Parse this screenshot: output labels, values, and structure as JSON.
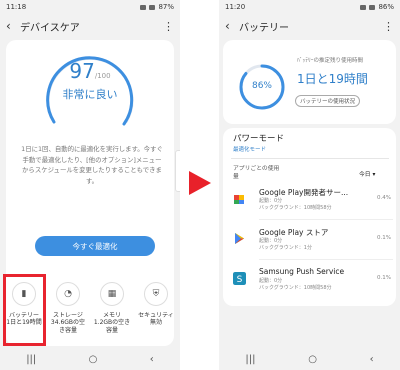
{
  "left": {
    "status": {
      "time": "11:18",
      "battery": "87%"
    },
    "title": "デバイスケア",
    "score": "97",
    "score_max": "/100",
    "score_label": "非常に良い",
    "description": "1日に1回、自動的に最適化を実行します。今すぐ手動で最適化したり、[他のオプション]メニューからスケジュールを変更したりすることもできます。",
    "optimize_button": "今すぐ最適化",
    "tiles": [
      {
        "label": "バッテリー",
        "value": "1日と19時間",
        "icon": "battery-icon"
      },
      {
        "label": "ストレージ",
        "value": "34.6GBの空き容量",
        "icon": "storage-icon"
      },
      {
        "label": "メモリ",
        "value": "1.2GBの空き容量",
        "icon": "memory-icon"
      },
      {
        "label": "セキュリティ",
        "value": "無効",
        "icon": "shield-icon"
      }
    ]
  },
  "right": {
    "status": {
      "time": "11:20",
      "battery": "86%"
    },
    "title": "バッテリー",
    "percent": "86%",
    "battery_level": 86,
    "remaining_label": "ﾊﾞｯﾃﾘｰの推定残り使用時間",
    "remaining_value": "1日と19時間",
    "usage_button": "バッテリーの使用状況",
    "power_mode_title": "パワーモード",
    "power_mode_value": "最適化モード",
    "app_usage_label": "アプリごとの使用量",
    "period": "今日",
    "apps": [
      {
        "name": "Google Play開発者サー...",
        "meta1": "起動：0分",
        "meta2": "バックグラウンド：10時間58分",
        "pct": "0.4%"
      },
      {
        "name": "Google Play ストア",
        "meta1": "起動：0分",
        "meta2": "バックグラウンド：1分",
        "pct": "0.1%"
      },
      {
        "name": "Samsung Push Service",
        "meta1": "起動：0分",
        "meta2": "バックグラウンド：10時間58分",
        "pct": "0.1%"
      }
    ]
  },
  "colors": {
    "accent": "#2f7fc9",
    "button": "#3d8fe0",
    "highlight": "#e8242f",
    "arrow": "#e8212a"
  }
}
